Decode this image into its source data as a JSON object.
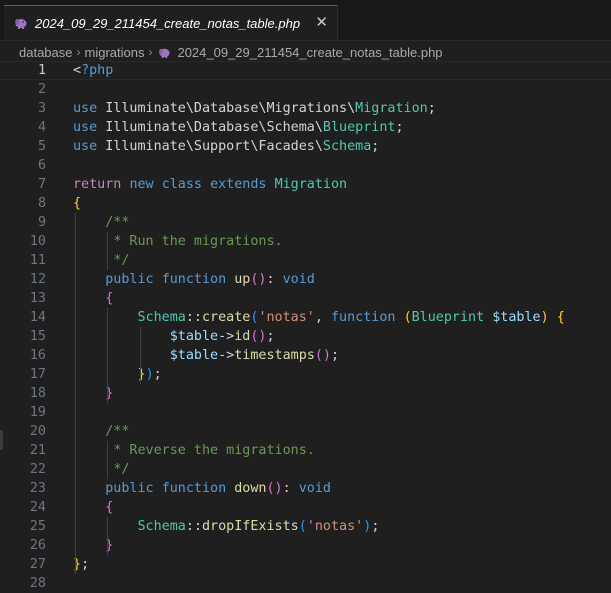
{
  "tab": {
    "title": "2024_09_29_211454_create_notas_table.php",
    "close_glyph": "✕",
    "icon": "php-elephant-icon"
  },
  "breadcrumb": {
    "items": [
      "database",
      "migrations",
      "2024_09_29_211454_create_notas_table.php"
    ],
    "separator": "›"
  },
  "colors": {
    "background": "#1f1f1f",
    "keyword": "#569cd6",
    "type": "#4ec9b0",
    "function": "#dcdcaa",
    "string": "#ce9178",
    "comment": "#6a9955",
    "variable": "#9cdcfe",
    "control": "#c586c0",
    "php_icon": "#a074c4"
  },
  "editor": {
    "current_line": 1,
    "lines": [
      {
        "n": "1",
        "tokens": [
          [
            "op",
            "<"
          ],
          [
            "tag",
            "?php"
          ]
        ]
      },
      {
        "n": "2",
        "tokens": []
      },
      {
        "n": "3",
        "tokens": [
          [
            "kw",
            "use"
          ],
          [
            "op",
            " Illuminate\\Database\\Migrations\\"
          ],
          [
            "ty",
            "Migration"
          ],
          [
            "op",
            ";"
          ]
        ]
      },
      {
        "n": "4",
        "tokens": [
          [
            "kw",
            "use"
          ],
          [
            "op",
            " Illuminate\\Database\\Schema\\"
          ],
          [
            "ty",
            "Blueprint"
          ],
          [
            "op",
            ";"
          ]
        ]
      },
      {
        "n": "5",
        "tokens": [
          [
            "kw",
            "use"
          ],
          [
            "op",
            " Illuminate\\Support\\Facades\\"
          ],
          [
            "ty",
            "Schema"
          ],
          [
            "op",
            ";"
          ]
        ]
      },
      {
        "n": "6",
        "tokens": []
      },
      {
        "n": "7",
        "tokens": [
          [
            "ctl",
            "return"
          ],
          [
            "op",
            " "
          ],
          [
            "kw",
            "new"
          ],
          [
            "op",
            " "
          ],
          [
            "kw",
            "class"
          ],
          [
            "op",
            " "
          ],
          [
            "kw",
            "extends"
          ],
          [
            "op",
            " "
          ],
          [
            "ty",
            "Migration"
          ]
        ]
      },
      {
        "n": "8",
        "tokens": [
          [
            "b1",
            "{"
          ]
        ]
      },
      {
        "n": "9",
        "tokens": [
          [
            "op",
            "    "
          ],
          [
            "cm",
            "/**"
          ]
        ]
      },
      {
        "n": "10",
        "tokens": [
          [
            "op",
            "     "
          ],
          [
            "cm",
            "* Run the migrations."
          ]
        ]
      },
      {
        "n": "11",
        "tokens": [
          [
            "op",
            "     "
          ],
          [
            "cm",
            "*/"
          ]
        ]
      },
      {
        "n": "12",
        "tokens": [
          [
            "op",
            "    "
          ],
          [
            "kw",
            "public"
          ],
          [
            "op",
            " "
          ],
          [
            "kw",
            "function"
          ],
          [
            "op",
            " "
          ],
          [
            "fn",
            "up"
          ],
          [
            "b2",
            "()"
          ],
          [
            "op",
            ": "
          ],
          [
            "kw",
            "void"
          ]
        ]
      },
      {
        "n": "13",
        "tokens": [
          [
            "op",
            "    "
          ],
          [
            "b2",
            "{"
          ]
        ]
      },
      {
        "n": "14",
        "tokens": [
          [
            "op",
            "        "
          ],
          [
            "ty",
            "Schema"
          ],
          [
            "op",
            "::"
          ],
          [
            "fn",
            "create"
          ],
          [
            "b3",
            "("
          ],
          [
            "str",
            "'notas'"
          ],
          [
            "op",
            ", "
          ],
          [
            "kw",
            "function"
          ],
          [
            "op",
            " "
          ],
          [
            "b1",
            "("
          ],
          [
            "ty",
            "Blueprint"
          ],
          [
            "op",
            " "
          ],
          [
            "var",
            "$table"
          ],
          [
            "b1",
            ")"
          ],
          [
            "op",
            " "
          ],
          [
            "b1",
            "{"
          ]
        ]
      },
      {
        "n": "15",
        "tokens": [
          [
            "op",
            "            "
          ],
          [
            "var",
            "$table"
          ],
          [
            "op",
            "->"
          ],
          [
            "fn",
            "id"
          ],
          [
            "b2",
            "()"
          ],
          [
            "op",
            ";"
          ]
        ]
      },
      {
        "n": "16",
        "tokens": [
          [
            "op",
            "            "
          ],
          [
            "var",
            "$table"
          ],
          [
            "op",
            "->"
          ],
          [
            "fn",
            "timestamps"
          ],
          [
            "b2",
            "()"
          ],
          [
            "op",
            ";"
          ]
        ]
      },
      {
        "n": "17",
        "tokens": [
          [
            "op",
            "        "
          ],
          [
            "b1",
            "}"
          ],
          [
            "b3",
            ")"
          ],
          [
            "op",
            ";"
          ]
        ]
      },
      {
        "n": "18",
        "tokens": [
          [
            "op",
            "    "
          ],
          [
            "b2",
            "}"
          ]
        ]
      },
      {
        "n": "19",
        "tokens": []
      },
      {
        "n": "20",
        "tokens": [
          [
            "op",
            "    "
          ],
          [
            "cm",
            "/**"
          ]
        ]
      },
      {
        "n": "21",
        "tokens": [
          [
            "op",
            "     "
          ],
          [
            "cm",
            "* Reverse the migrations."
          ]
        ]
      },
      {
        "n": "22",
        "tokens": [
          [
            "op",
            "     "
          ],
          [
            "cm",
            "*/"
          ]
        ]
      },
      {
        "n": "23",
        "tokens": [
          [
            "op",
            "    "
          ],
          [
            "kw",
            "public"
          ],
          [
            "op",
            " "
          ],
          [
            "kw",
            "function"
          ],
          [
            "op",
            " "
          ],
          [
            "fn",
            "down"
          ],
          [
            "b2",
            "()"
          ],
          [
            "op",
            ": "
          ],
          [
            "kw",
            "void"
          ]
        ]
      },
      {
        "n": "24",
        "tokens": [
          [
            "op",
            "    "
          ],
          [
            "b2",
            "{"
          ]
        ]
      },
      {
        "n": "25",
        "tokens": [
          [
            "op",
            "        "
          ],
          [
            "ty",
            "Schema"
          ],
          [
            "op",
            "::"
          ],
          [
            "fn",
            "dropIfExists"
          ],
          [
            "b3",
            "("
          ],
          [
            "str",
            "'notas'"
          ],
          [
            "b3",
            ")"
          ],
          [
            "op",
            ";"
          ]
        ]
      },
      {
        "n": "26",
        "tokens": [
          [
            "op",
            "    "
          ],
          [
            "b2",
            "}"
          ]
        ]
      },
      {
        "n": "27",
        "tokens": [
          [
            "b1",
            "}"
          ],
          [
            "op",
            ";"
          ]
        ]
      },
      {
        "n": "28",
        "tokens": []
      }
    ]
  }
}
